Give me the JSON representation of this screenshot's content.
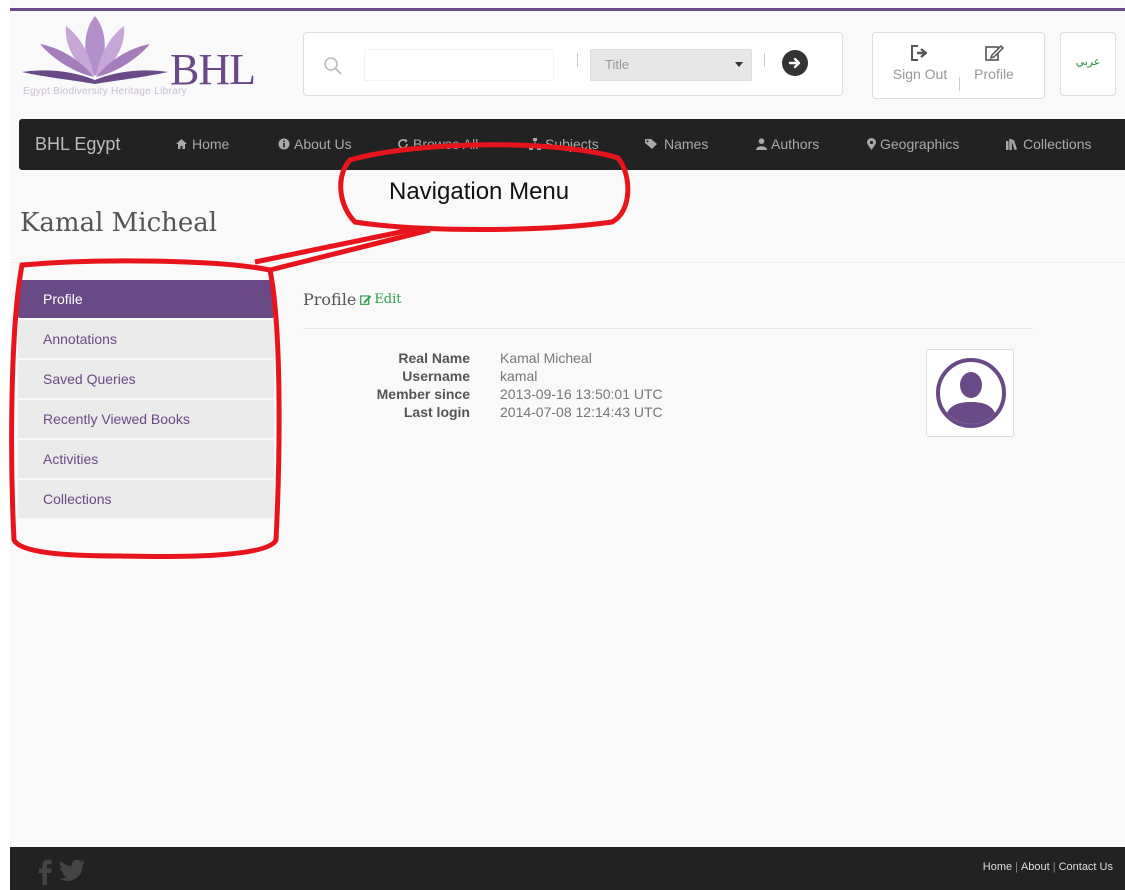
{
  "header": {
    "logo_text": "BHL",
    "logo_subtitle": "Egypt Biodiversity Heritage Library",
    "search": {
      "placeholder": "",
      "type_selected": "Title"
    },
    "user": {
      "signout_label": "Sign Out",
      "profile_label": "Profile"
    },
    "language_label": "عربي"
  },
  "nav": {
    "brand": "BHL Egypt",
    "items": [
      {
        "label": "Home",
        "icon": "home-icon"
      },
      {
        "label": "About Us",
        "icon": "info-icon"
      },
      {
        "label": "Browse All",
        "icon": "refresh-icon"
      },
      {
        "label": "Subjects",
        "icon": "sitemap-icon"
      },
      {
        "label": "Names",
        "icon": "tags-icon"
      },
      {
        "label": "Authors",
        "icon": "user-icon"
      },
      {
        "label": "Geographics",
        "icon": "map-marker-icon"
      },
      {
        "label": "Collections",
        "icon": "books-icon"
      }
    ]
  },
  "page": {
    "title": "Kamal Micheal"
  },
  "sidebar": {
    "items": [
      {
        "label": "Profile",
        "active": true
      },
      {
        "label": "Annotations"
      },
      {
        "label": "Saved Queries"
      },
      {
        "label": "Recently Viewed Books"
      },
      {
        "label": "Activities"
      },
      {
        "label": "Collections"
      }
    ]
  },
  "profile": {
    "section_title": "Profile",
    "edit_label": "Edit",
    "fields": [
      {
        "label": "Real Name",
        "value": "Kamal Micheal"
      },
      {
        "label": "Username",
        "value": "kamal"
      },
      {
        "label": "Member since",
        "value": "2013-09-16 13:50:01 UTC"
      },
      {
        "label": "Last login",
        "value": "2014-07-08 12:14:43 UTC"
      }
    ]
  },
  "annotation": {
    "label": "Navigation Menu",
    "color": "#e8141c"
  },
  "footer": {
    "links": [
      "Home",
      "About",
      "Contact Us"
    ]
  },
  "colors": {
    "brand": "#6a4a86",
    "nav_bg": "#222222",
    "edit": "#2a9d4e"
  }
}
